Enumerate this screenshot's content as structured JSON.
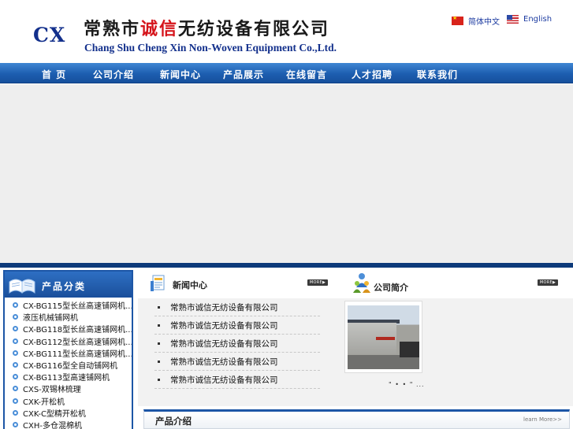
{
  "header": {
    "logo_text": "CX",
    "cn_name_a": "常熟市",
    "cn_name_red": "诚信",
    "cn_name_b": "无纺设备有限公司",
    "en_name": "Chang Shu Cheng Xin Non-Woven Equipment Co.,Ltd.",
    "lang_cn": "简体中文",
    "lang_en": "English"
  },
  "nav": {
    "items": [
      "首  页",
      "公司介绍",
      "新闻中心",
      "产品展示",
      "在线留言",
      "人才招聘",
      "联系我们"
    ]
  },
  "sidebar": {
    "title": "产品分类",
    "items": [
      "CX-BG115型长丝高速铺网机...",
      "液压机械铺网机",
      "CX-BG118型长丝高速铺网机...",
      "CX-BG112型长丝高速铺网机...",
      "CX-BG111型长丝高速铺网机...",
      "CX-BG116型全自动铺网机",
      "CX-BG113型高速铺网机",
      "CXS-双锡林梳理",
      "CXK-开松机",
      "CXK-C型精开松机",
      "CXH-多仓混棉机"
    ]
  },
  "news": {
    "title": "新闻中心",
    "more": "MORE▶",
    "items": [
      "常熟市诚信无纺设备有限公司",
      "常熟市诚信无纺设备有限公司",
      "常熟市诚信无纺设备有限公司",
      "常熟市诚信无纺设备有限公司",
      "常熟市诚信无纺设备有限公司"
    ]
  },
  "company": {
    "title": "公司简介",
    "more": "MORE▶",
    "text": "\" • • \" ..."
  },
  "products": {
    "title": "产品介绍",
    "learn_more": "learn More>>"
  },
  "colors": {
    "nav_blue": "#1d5eb0",
    "brand_navy": "#13308c",
    "brand_red": "#d5141b"
  }
}
